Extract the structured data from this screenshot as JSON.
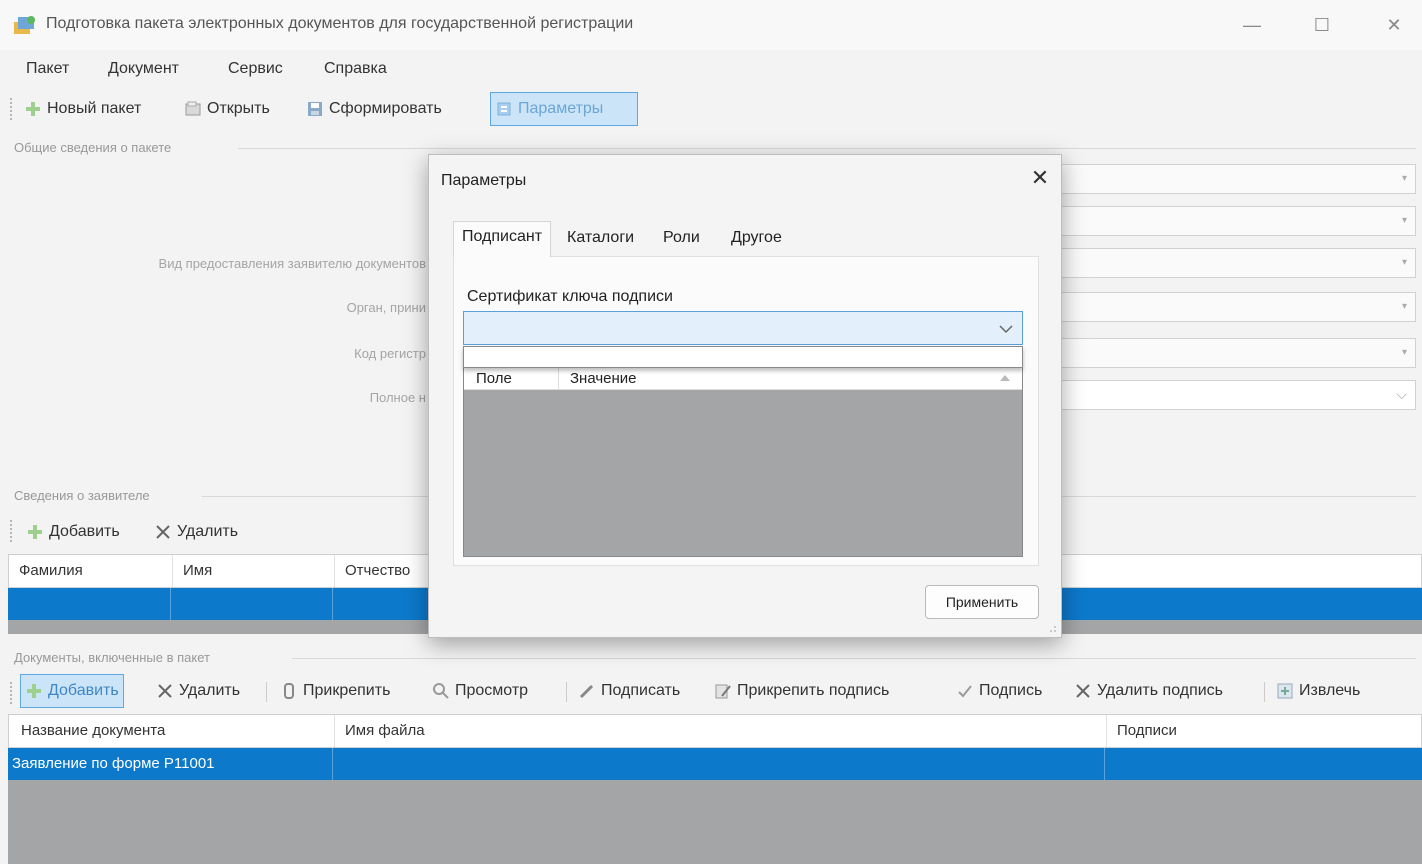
{
  "window": {
    "title": "Подготовка пакета электронных документов для государственной регистрации",
    "minimize": "—",
    "maximize": "☐",
    "close": "✕"
  },
  "menu": [
    "Пакет",
    "Документ",
    "Сервис",
    "Справка"
  ],
  "toolbar": {
    "new_package": "Новый пакет",
    "open": "Открыть",
    "build": "Сформировать",
    "params": "Параметры"
  },
  "package_info": {
    "group_label": "Общие сведения о пакете",
    "fields": [
      {
        "label": "Вид предоставления заявителю документов"
      },
      {
        "label": "Орган, прини"
      },
      {
        "label": "Код регистр"
      },
      {
        "label": "Полное н"
      }
    ]
  },
  "applicant": {
    "group_label": "Сведения о заявителе",
    "add": "Добавить",
    "delete": "Удалить",
    "columns": [
      "Фамилия",
      "Имя",
      "Отчество"
    ]
  },
  "documents": {
    "group_label": "Документы, включенные в пакет",
    "toolbar": {
      "add": "Добавить",
      "delete": "Удалить",
      "attach": "Прикрепить",
      "view": "Просмотр",
      "sign": "Подписать",
      "attach_signature": "Прикрепить подпись",
      "signature": "Подпись",
      "delete_signature": "Удалить подпись",
      "extract": "Извлечь"
    },
    "columns": [
      "Название документа",
      "Имя файла",
      "Подписи"
    ],
    "rows": [
      {
        "name": "Заявление по форме Р11001",
        "file": "",
        "signatures": ""
      }
    ]
  },
  "dialog": {
    "title": "Параметры",
    "close": "✕",
    "tabs": [
      "Подписант",
      "Каталоги",
      "Роли",
      "Другое"
    ],
    "cert_label": "Сертификат ключа подписи",
    "cert_value": "",
    "grid_columns": [
      "Поле",
      "Значение"
    ],
    "apply": "Применить"
  },
  "colors": {
    "selection": "#0c79cb",
    "grid_empty": "#a3a5a7",
    "focus": "#5a9fd8"
  }
}
